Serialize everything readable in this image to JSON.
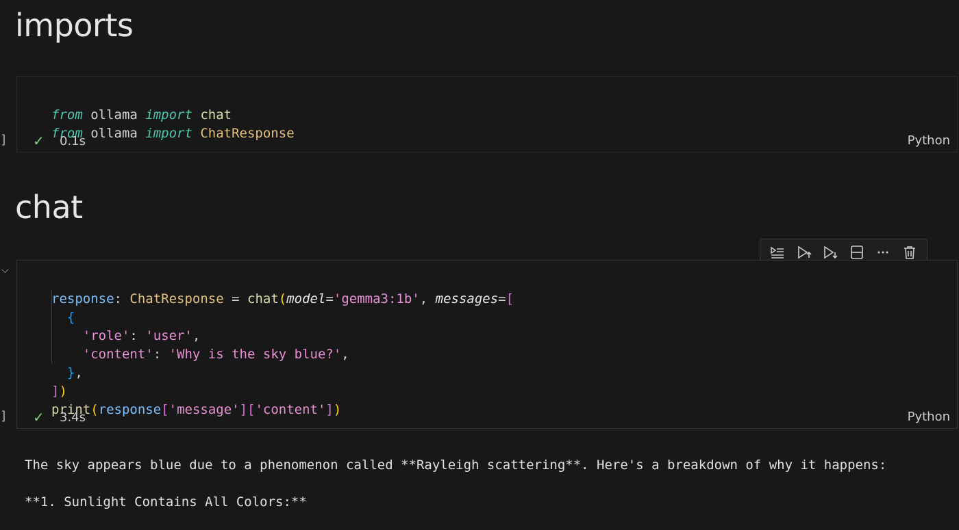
{
  "sections": [
    {
      "heading": "imports"
    },
    {
      "heading": "chat"
    }
  ],
  "cell1": {
    "line1": {
      "kw1": "from",
      "mod": " ollama ",
      "kw2": "import",
      "name": " chat"
    },
    "line2": {
      "kw1": "from",
      "mod": " ollama ",
      "kw2": "import",
      "name": " ChatResponse"
    },
    "status": {
      "check": "✓",
      "time": "0.1s"
    },
    "language": "Python"
  },
  "cell2": {
    "l1": {
      "var": "response",
      "colon": ": ",
      "type": "ChatResponse",
      "eq": " = ",
      "fn": "chat",
      "p1": "model",
      "eq1": "=",
      "s1": "'gemma3:1b'",
      "comma": ", ",
      "p2": "messages",
      "eq2": "="
    },
    "l3": {
      "key": "'role'",
      "sep": ": ",
      "val": "'user'",
      "comma": ","
    },
    "l4": {
      "key": "'content'",
      "sep": ": ",
      "val": "'Why is the sky blue?'",
      "comma": ","
    },
    "l5": {
      "comma": ","
    },
    "l7": {
      "fn": "print",
      "var": "response",
      "k1": "'message'",
      "k2": "'content'"
    },
    "status": {
      "check": "✓",
      "time": "3.4s"
    },
    "language": "Python",
    "toolbar": {
      "icons": [
        "run-by-line-icon",
        "execute-above-icon",
        "execute-below-icon",
        "split-cell-icon",
        "more-icon",
        "delete-icon"
      ]
    }
  },
  "output": {
    "line1": "The sky appears blue due to a phenomenon called **Rayleigh scattering**. Here's a breakdown of why it happens:",
    "line2": "**1. Sunlight Contains All Colors:**"
  }
}
